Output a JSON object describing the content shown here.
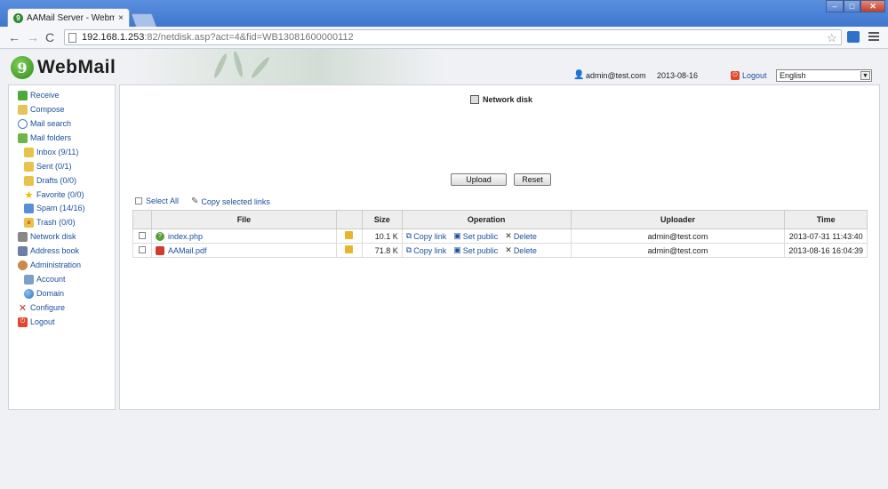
{
  "browser": {
    "tab_title": "AAMail Server - Webmail",
    "tab_close": "×",
    "url_host": "192.168.1.253",
    "url_rest": ":82/netdisk.asp?act=4&fid=WB13081600000112",
    "back": "←",
    "forward": "→",
    "reload": "C",
    "star": "☆",
    "window_min": "–",
    "window_max": "□",
    "window_close": "✕"
  },
  "header": {
    "logo_badge": "9",
    "logo_text": "WebMail",
    "user_email": "admin@test.com",
    "date": "2013-08-16",
    "logout_label": "Logout",
    "language": "English",
    "language_arrow": "▼"
  },
  "sidebar": {
    "items": [
      {
        "label": "Receive",
        "icon": "receive-icon"
      },
      {
        "label": "Compose",
        "icon": "compose-icon"
      },
      {
        "label": "Mail search",
        "icon": "search-icon"
      },
      {
        "label": "Mail folders",
        "icon": "folders-icon"
      },
      {
        "label": "Inbox (9/11)",
        "icon": "inbox-icon"
      },
      {
        "label": "Sent (0/1)",
        "icon": "sent-icon"
      },
      {
        "label": "Drafts (0/0)",
        "icon": "drafts-icon"
      },
      {
        "label": "Favorite (0/0)",
        "icon": "star-icon"
      },
      {
        "label": "Spam (14/16)",
        "icon": "spam-icon"
      },
      {
        "label": "Trash (0/0)",
        "icon": "trash-icon"
      },
      {
        "label": "Network disk",
        "icon": "disk-icon"
      },
      {
        "label": "Address book",
        "icon": "address-book-icon"
      },
      {
        "label": "Administration",
        "icon": "admin-icon"
      },
      {
        "label": "Account",
        "icon": "account-icon"
      },
      {
        "label": "Domain",
        "icon": "globe-icon"
      },
      {
        "label": "Configure",
        "icon": "tools-icon"
      },
      {
        "label": "Logout",
        "icon": "logout-icon"
      }
    ]
  },
  "main": {
    "title": "Network disk",
    "upload_label": "Upload",
    "reset_label": "Reset",
    "select_all_label": "Select All",
    "copy_selected_label": "Copy selected links",
    "columns": {
      "file": "File",
      "size": "Size",
      "operation": "Operation",
      "uploader": "Uploader",
      "time": "Time"
    },
    "ops": {
      "copy": "Copy link",
      "public": "Set public",
      "delete": "Delete"
    },
    "rows": [
      {
        "name": "index.php",
        "size": "10.1 K",
        "uploader": "admin@test.com",
        "time": "2013-07-31 11:43:40"
      },
      {
        "name": "AAMail.pdf",
        "size": "71.8 K",
        "uploader": "admin@test.com",
        "time": "2013-08-16 16:04:39"
      }
    ]
  },
  "colors": {
    "link": "#1a4f9c",
    "chrome": "#3f76cf",
    "logout_red": "#e0472c"
  }
}
